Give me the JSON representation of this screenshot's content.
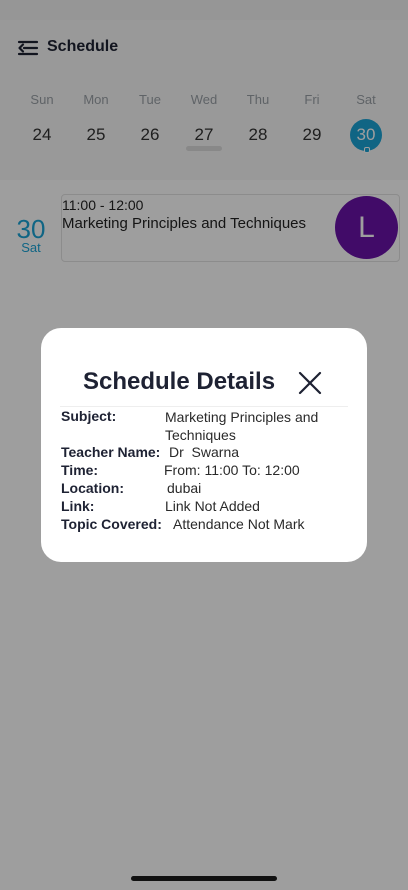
{
  "header": {
    "title": "Schedule",
    "menu_icon": "menu-back-icon"
  },
  "week": [
    {
      "name": "Sun",
      "num": "24"
    },
    {
      "name": "Mon",
      "num": "25"
    },
    {
      "name": "Tue",
      "num": "26"
    },
    {
      "name": "Wed",
      "num": "27"
    },
    {
      "name": "Thu",
      "num": "28"
    },
    {
      "name": "Fri",
      "num": "29"
    },
    {
      "name": "Sat",
      "num": "30"
    }
  ],
  "selected_day": {
    "num": "30",
    "name": "Sat"
  },
  "event": {
    "time": "11:00 - 12:00",
    "subject": "Marketing Principles and Techniques",
    "avatar_letter": "L"
  },
  "modal": {
    "title": "Schedule Details",
    "close_icon": "close-icon",
    "rows": [
      {
        "label": "Subject:",
        "value": "Marketing Principles and Techniques"
      },
      {
        "label": "Teacher Name:",
        "value": "Dr  Swarna"
      },
      {
        "label": "Time:",
        "value": "From: 11:00 To: 12:00"
      },
      {
        "label": "Location:",
        "value": "dubai"
      },
      {
        "label": "Link:",
        "value": "Link Not Added"
      },
      {
        "label": "Topic Covered:",
        "value": "Attendance Not Mark"
      }
    ]
  },
  "colors": {
    "accent": "#1aa3d6",
    "avatar": "#6a12a8",
    "title": "#1e2233"
  }
}
